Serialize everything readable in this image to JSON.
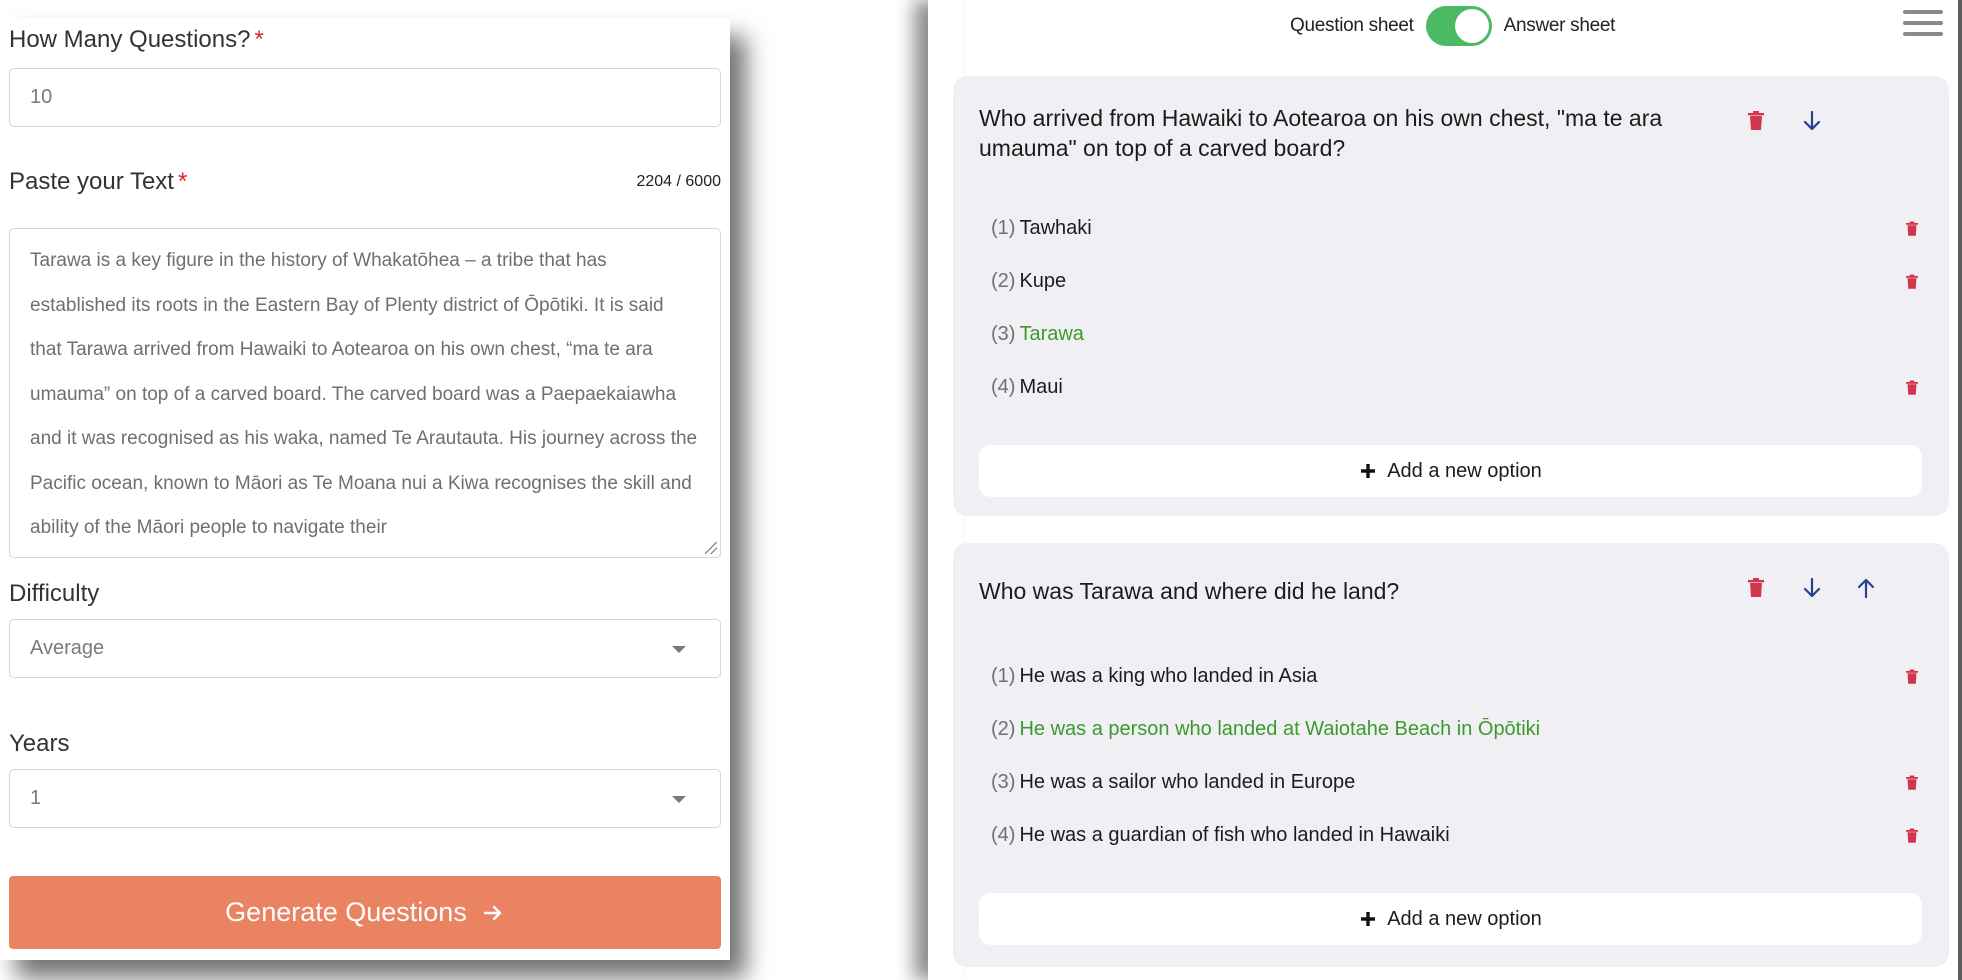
{
  "form": {
    "questions_label": "How Many Questions?",
    "questions_value": "10",
    "text_label": "Paste your Text",
    "char_count": "2204 / 6000",
    "text_value": "Tarawa is a key figure in the history of Whakatōhea – a tribe that has established its roots in the Eastern Bay of Plenty district of Ōpōtiki.  It is said that Tarawa arrived from Hawaiki to Aotearoa on his own chest, “ma te ara umauma” on top of a carved board. The carved board was a Paepaekaiawha and it was recognised as his waka, named Te Arautauta. His journey across the Pacific ocean, known to Māori as Te Moana nui a Kiwa recognises the skill and ability of the Māori people to navigate their",
    "required_mark": "*",
    "difficulty_label": "Difficulty",
    "difficulty_value": "Average",
    "years_label": "Years",
    "years_value": "1",
    "generate_label": "Generate Questions",
    "generate_icon": "arrow-right-icon"
  },
  "toggle": {
    "left_label": "Question sheet",
    "right_label": "Answer sheet",
    "on": true,
    "color": "#4cba63"
  },
  "colors": {
    "accent_button": "#e98361",
    "delete_icon": "#d2364d",
    "arrow_icon": "#2a3f8f",
    "correct_answer": "#3c9a2c"
  },
  "questions": [
    {
      "title": "Who arrived from Hawaiki to Aotearoa on his own chest, \"ma te ara umauma\" on top of a carved board?",
      "options": [
        {
          "num": "(1)",
          "text": "Tawhaki",
          "correct": false
        },
        {
          "num": "(2)",
          "text": "Kupe",
          "correct": false
        },
        {
          "num": "(3)",
          "text": "Tarawa",
          "correct": true
        },
        {
          "num": "(4)",
          "text": "Maui",
          "correct": false
        }
      ],
      "add_option_label": "Add a new option"
    },
    {
      "title": "Who was Tarawa and where did he land?",
      "options": [
        {
          "num": "(1)",
          "text": "He was a king who landed in Asia",
          "correct": false
        },
        {
          "num": "(2)",
          "text": "He was a person who landed at Waiotahe Beach in Ōpōtiki",
          "correct": true
        },
        {
          "num": "(3)",
          "text": "He was a sailor who landed in Europe",
          "correct": false
        },
        {
          "num": "(4)",
          "text": "He was a guardian of fish who landed in Hawaiki",
          "correct": false
        }
      ],
      "add_option_label": "Add a new option"
    }
  ]
}
